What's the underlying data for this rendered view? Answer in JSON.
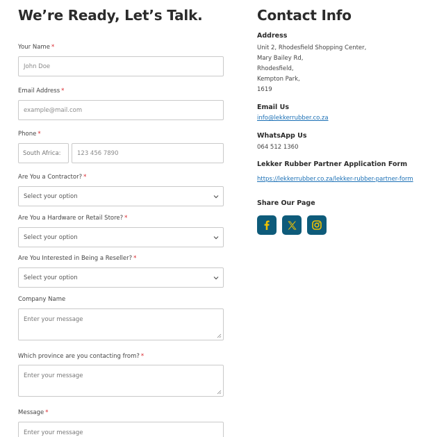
{
  "form": {
    "title": "We’re Ready, Let’s Talk.",
    "required_mark": "*",
    "name": {
      "label": "Your Name",
      "placeholder": "John Doe"
    },
    "email": {
      "label": "Email Address",
      "placeholder": "example@mail.com"
    },
    "phone": {
      "label": "Phone",
      "country": "South Africa:",
      "placeholder": "123 456 7890"
    },
    "contractor": {
      "label": "Are You a Contractor?",
      "value": "Select your option"
    },
    "hardware": {
      "label": "Are You a Hardware or Retail Store?",
      "value": "Select your option"
    },
    "reseller": {
      "label": "Are You Interested in Being a Reseller?",
      "value": "Select your option"
    },
    "company": {
      "label": "Company Name",
      "placeholder": "Enter your message"
    },
    "province": {
      "label": "Which province are you contacting from?",
      "placeholder": "Enter your message"
    },
    "message": {
      "label": "Message",
      "placeholder": "Enter your message"
    }
  },
  "contact": {
    "title": "Contact Info",
    "address_heading": "Address",
    "address_lines": [
      "Unit 2, Rhodesfield Shopping Center,",
      "Mary Bailey Rd,",
      "Rhodesfield,",
      "Kempton Park,",
      "1619"
    ],
    "email_heading": "Email Us",
    "email": "info@lekkerrubber.co.za",
    "whatsapp_heading": "WhatsApp Us",
    "whatsapp": "064 512 1360",
    "partner_heading": "Lekker Rubber Partner Application Form",
    "partner_link": "https://lekkerrubber.co.za/lekker-rubber-partner-form",
    "share_heading": "Share Our Page"
  },
  "colors": {
    "accent": "#0e5b7a",
    "icon": "#f2c200",
    "required": "#d9262b",
    "link": "#1a6fb5"
  },
  "social": [
    "facebook-icon",
    "x-icon",
    "instagram-icon"
  ]
}
